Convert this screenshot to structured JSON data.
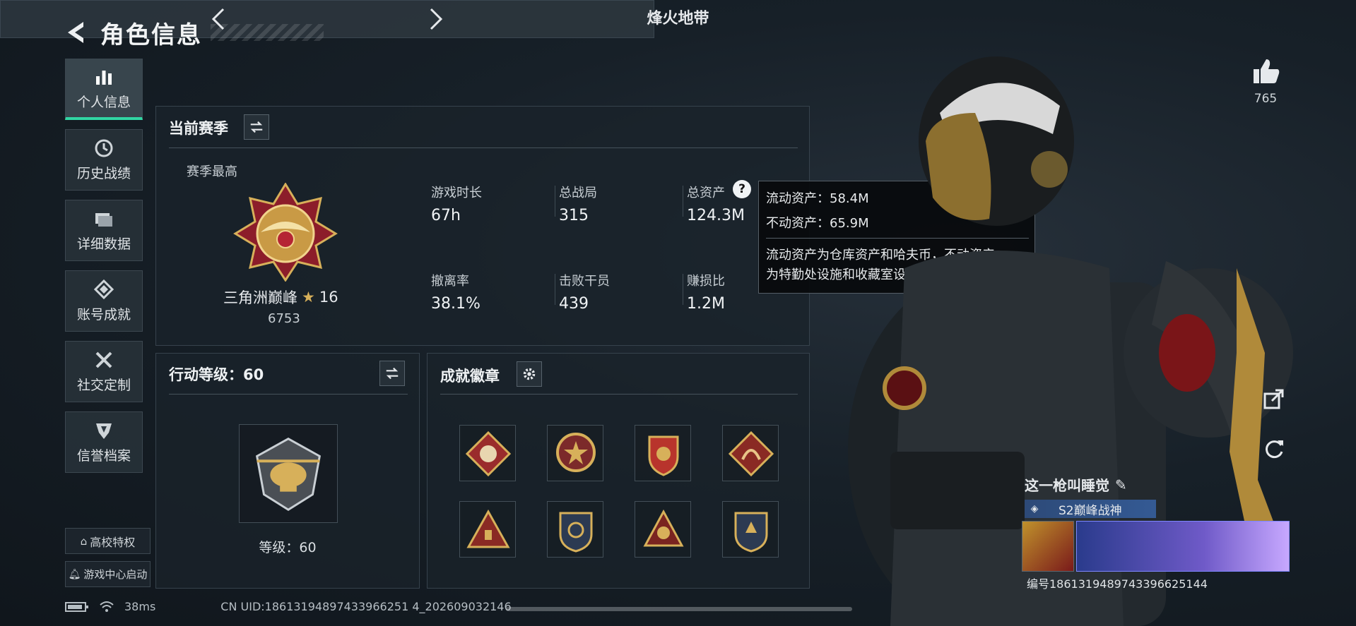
{
  "header": {
    "title": "角色信息"
  },
  "sidebar": {
    "items": [
      {
        "label": "个人信息",
        "icon": "bar-chart-icon"
      },
      {
        "label": "历史战绩",
        "icon": "clock-icon"
      },
      {
        "label": "详细数据",
        "icon": "folder-icon"
      },
      {
        "label": "账号成就",
        "icon": "achievement-icon"
      },
      {
        "label": "社交定制",
        "icon": "tools-icon"
      },
      {
        "label": "信誉档案",
        "icon": "shield-icon"
      }
    ],
    "campus_label": "高校特权",
    "game_center_label": "游戏中心启动"
  },
  "mode": {
    "name": "烽火地带"
  },
  "season": {
    "title": "当前赛季",
    "best_label": "赛季最高",
    "rank_name": "三角洲巅峰",
    "rank_stars": "16",
    "rank_score": "6753",
    "stats": [
      {
        "label": "游戏时长",
        "value": "67h"
      },
      {
        "label": "总战局",
        "value": "315"
      },
      {
        "label": "总资产",
        "value": "124.3M"
      },
      {
        "label": "撤离率",
        "value": "38.1%"
      },
      {
        "label": "击败干员",
        "value": "439"
      },
      {
        "label": "赚损比",
        "value": "1.2M"
      }
    ]
  },
  "tooltip": {
    "liquid": "流动资产：58.4M",
    "fixed": "不动资产：65.9M",
    "desc1": "流动资产为仓库资产和哈夫币，不动资产",
    "desc2": "为特勤处设施和收藏室设施"
  },
  "action_level": {
    "title": "行动等级：60",
    "level_text": "等级：60"
  },
  "badges": {
    "title": "成就徽章"
  },
  "likes": {
    "count": "765"
  },
  "profile": {
    "name": "这一枪叫睡觉",
    "title": "S2巅峰战神",
    "id_text": "编号1861319489743396625144"
  },
  "status": {
    "ping": "38ms",
    "uid": "CN UID:18613194897433966251 4_202609032146"
  },
  "colors": {
    "accent": "#31d6a3",
    "gold": "#d7b05a"
  }
}
